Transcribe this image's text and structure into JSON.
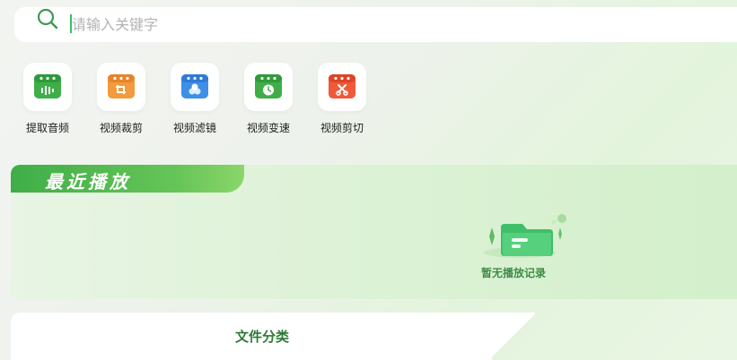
{
  "search": {
    "placeholder": "请输入关键字"
  },
  "tools": [
    {
      "label": "提取音频",
      "icon": "audio-extract-icon",
      "color": "#3fae48"
    },
    {
      "label": "视频裁剪",
      "icon": "video-crop-icon",
      "color": "#f29a3c"
    },
    {
      "label": "视频滤镜",
      "icon": "video-filter-icon",
      "color": "#3d8fe8"
    },
    {
      "label": "视频变速",
      "icon": "video-speed-icon",
      "color": "#3fae48"
    },
    {
      "label": "视频剪切",
      "icon": "video-cut-icon",
      "color": "#ee5a3a"
    }
  ],
  "recent": {
    "title": "最近播放",
    "empty_text": "暂无播放记录"
  },
  "category": {
    "title": "文件分类"
  },
  "colors": {
    "accent": "#3fae48",
    "accent_text": "#2d7a34"
  }
}
